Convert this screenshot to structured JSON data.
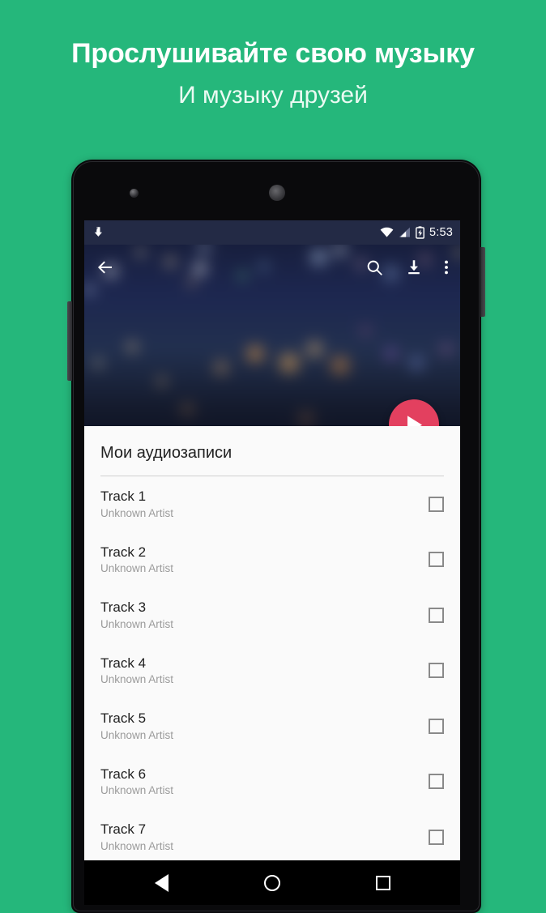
{
  "promo": {
    "title": "Прослушивайте свою музыку",
    "subtitle": "И музыку друзей",
    "background_color": "#25b77b"
  },
  "device": {
    "frame_color": "#0a0a0c",
    "camera_icon": "front-camera",
    "earpiece_icon": "earpiece-speaker",
    "volume_button": "volume-rocker",
    "power_button": "power-button"
  },
  "status_bar": {
    "notification_icon": "music-download-notification-icon",
    "wifi_icon": "wifi-icon",
    "signal_icon": "cellular-signal-icon",
    "battery_icon": "battery-charging-icon",
    "time": "5:53",
    "background_color": "#232a45"
  },
  "toolbar": {
    "back_icon": "back-arrow-icon",
    "search_icon": "search-icon",
    "download_icon": "download-icon",
    "overflow_icon": "overflow-menu-icon"
  },
  "hero": {
    "description": "blurred night cityscape bokeh"
  },
  "fab": {
    "icon": "play-icon",
    "color": "#e3405f"
  },
  "list": {
    "section_title": "Мои аудиозаписи",
    "tracks": [
      {
        "title": "Track 1",
        "artist": "Unknown Artist",
        "checked": false
      },
      {
        "title": "Track 2",
        "artist": "Unknown Artist",
        "checked": false
      },
      {
        "title": "Track 3",
        "artist": "Unknown Artist",
        "checked": false
      },
      {
        "title": "Track 4",
        "artist": "Unknown Artist",
        "checked": false
      },
      {
        "title": "Track 5",
        "artist": "Unknown Artist",
        "checked": false
      },
      {
        "title": "Track 6",
        "artist": "Unknown Artist",
        "checked": false
      },
      {
        "title": "Track 7",
        "artist": "Unknown Artist",
        "checked": false
      }
    ]
  },
  "nav_bar": {
    "back_icon": "nav-back-icon",
    "home_icon": "nav-home-icon",
    "recents_icon": "nav-recents-icon"
  }
}
